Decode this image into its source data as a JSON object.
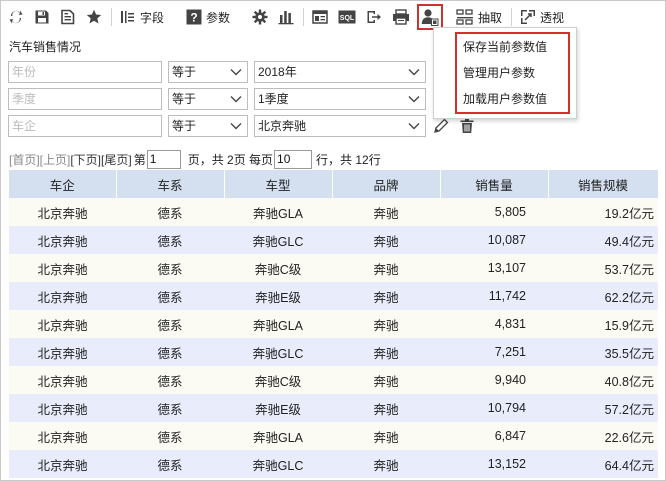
{
  "toolbar": {
    "field_label": "字段",
    "param_label": "参数",
    "extract_label": "抽取",
    "pivot_label": "透视",
    "sql_text": "SQL"
  },
  "user_param_menu": {
    "items": [
      "保存当前参数值",
      "管理用户参数",
      "加载用户参数值"
    ]
  },
  "report": {
    "title": "汽车销售情况"
  },
  "filters": [
    {
      "field_placeholder": "年份",
      "operator": "等于",
      "value": "2018年"
    },
    {
      "field_placeholder": "季度",
      "operator": "等于",
      "value": "1季度"
    },
    {
      "field_placeholder": "车企",
      "operator": "等于",
      "value": "北京奔驰"
    }
  ],
  "pager": {
    "first": "[首页]",
    "prev": "[上页]",
    "next": "[下页]",
    "last": "[尾页]",
    "page_prefix": "第",
    "current_page": "1",
    "page_suffix": "页，共 2页 每页",
    "page_size": "10",
    "size_suffix": "行，共 12行"
  },
  "table": {
    "columns": [
      "车企",
      "车系",
      "车型",
      "品牌",
      "销售量",
      "销售规模"
    ],
    "rows": [
      [
        "北京奔驰",
        "德系",
        "奔驰GLA",
        "奔驰",
        "5,805",
        "19.2亿元"
      ],
      [
        "北京奔驰",
        "德系",
        "奔驰GLC",
        "奔驰",
        "10,087",
        "49.4亿元"
      ],
      [
        "北京奔驰",
        "德系",
        "奔驰C级",
        "奔驰",
        "13,107",
        "53.7亿元"
      ],
      [
        "北京奔驰",
        "德系",
        "奔驰E级",
        "奔驰",
        "11,742",
        "62.2亿元"
      ],
      [
        "北京奔驰",
        "德系",
        "奔驰GLA",
        "奔驰",
        "4,831",
        "15.9亿元"
      ],
      [
        "北京奔驰",
        "德系",
        "奔驰GLC",
        "奔驰",
        "7,251",
        "35.5亿元"
      ],
      [
        "北京奔驰",
        "德系",
        "奔驰C级",
        "奔驰",
        "9,940",
        "40.8亿元"
      ],
      [
        "北京奔驰",
        "德系",
        "奔驰E级",
        "奔驰",
        "10,794",
        "57.2亿元"
      ],
      [
        "北京奔驰",
        "德系",
        "奔驰GLA",
        "奔驰",
        "6,847",
        "22.6亿元"
      ],
      [
        "北京奔驰",
        "德系",
        "奔驰GLC",
        "奔驰",
        "13,152",
        "64.4亿元"
      ]
    ]
  },
  "colors": {
    "header_bg": "#d4dff0",
    "row_odd": "#fbfaf3",
    "row_even": "#e8ecfb",
    "highlight": "#d32f2f"
  }
}
